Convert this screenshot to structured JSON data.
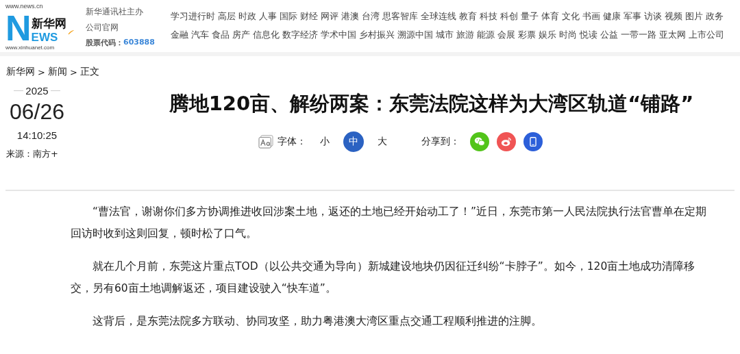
{
  "logo": {
    "top_url": "www.news.cn",
    "name": "新华网",
    "news_initial": "N",
    "news": "EWS",
    "bottom_url": "www.xinhuanet.com"
  },
  "org": {
    "line_1": "新华通讯社主办",
    "line_2": "公司官网",
    "stock_label": "股票代码：",
    "stock_code": "603888"
  },
  "nav_rows": [
    [
      "学习进行时",
      "高层",
      "时政",
      "人事",
      "国际",
      "财经",
      "网评",
      "港澳",
      "台湾",
      "思客智库",
      "全球连线",
      "教育",
      "科技",
      "科创",
      "量子",
      "体育",
      "文化",
      "书画",
      "健康",
      "军事",
      "访谈",
      "视频",
      "图片",
      "政务"
    ],
    [
      "金融",
      "汽车",
      "食品",
      "房产",
      "信息化",
      "数字经济",
      "学术中国",
      "乡村振兴",
      "溯源中国",
      "城市",
      "旅游",
      "能源",
      "会展",
      "彩票",
      "娱乐",
      "时尚",
      "悦读",
      "公益",
      "一带一路",
      "亚太网",
      "上市公司"
    ]
  ],
  "breadcrumb": [
    "新华网",
    "新闻",
    "正文"
  ],
  "breadcrumb_separator": ">",
  "date": {
    "year": "2025",
    "day": "06/26",
    "time": "14:10:25",
    "source": "来源：南方+"
  },
  "title": "腾地120亩、解纷两案：东莞法院这样为大湾区轨道“铺路”",
  "font_size": {
    "label": "字体：",
    "options": [
      {
        "label": "小",
        "selected": false
      },
      {
        "label": "中",
        "selected": true
      },
      {
        "label": "大",
        "selected": false
      }
    ]
  },
  "share": {
    "label": "分享到：",
    "targets": [
      {
        "kind": "wechat",
        "color": "#52c41a"
      },
      {
        "kind": "weibo",
        "color": "#f05454"
      },
      {
        "kind": "mobile",
        "color": "#2c5fd9"
      }
    ]
  },
  "paragraphs": [
    "“曹法官，谢谢你们多方协调推进收回涉案土地，返还的土地已经开始动工了！”近日，东莞市第一人民法院执行法官曹单在定期回访时收到这则回复，顿时松了口气。",
    "就在几个月前，东莞这片重点TOD（以公共交通为导向）新城建设地块仍因征迁纠纷“卡脖子”。如今，120亩土地成功清障移交，另有60亩土地调解返还，项目建设驶入“快车道”。",
    "这背后，是东莞法院多方联动、协同攻坚，助力粤港澳大湾区重点交通工程顺利推进的注脚。"
  ]
}
